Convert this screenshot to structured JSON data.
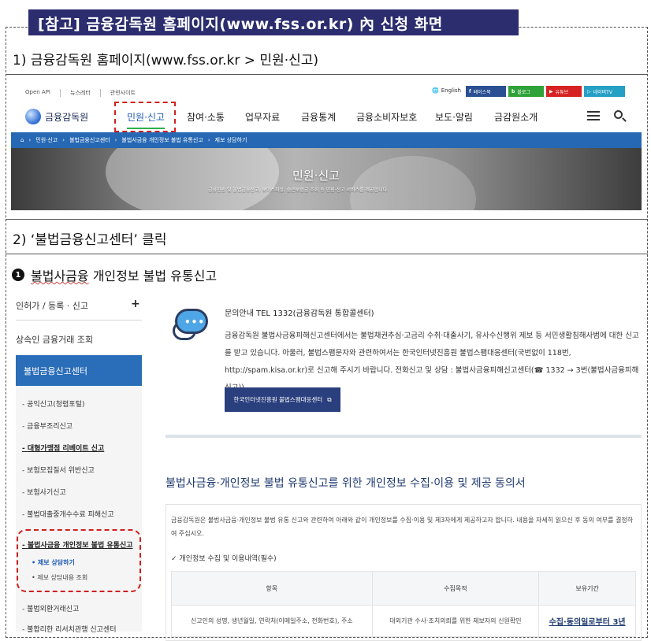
{
  "banner_title": "[참고] 금융감독원 홈페이지(www.fss.or.kr) 內 신청 화면",
  "step1": "1)  금융감독원 홈페이지(www.fss.or.kr  >  민원·신고)",
  "step2": "2)  ‘불법금융신고센터’ 클릭",
  "site": {
    "util_links": [
      "Open API",
      "뉴스레터",
      "관련사이트"
    ],
    "lang": "English",
    "social": [
      "페이스북",
      "블로그",
      "유튜브",
      "네이버TV"
    ],
    "logo": "금융감독원",
    "menu": [
      "민원·신고",
      "참여·소통",
      "업무자료",
      "금융통계",
      "금융소비자보호",
      "보도·알림",
      "금감원소개"
    ],
    "breadcrumb": [
      "민원·신고",
      "불법금융신고센터",
      "불법사금융 개인정보 불법 유통신고",
      "제보 상담하기"
    ],
    "hero_title": "민원·신고",
    "hero_sub": "금융민원 및 불법금융신고, 보이스피싱, 숨은보험금 조회 등 민원·신고 서비스를 제공합니다."
  },
  "bullet": {
    "num": "1",
    "part1": "불법사금융",
    "part2": " 개인정보 불법 유통신고"
  },
  "left_nav": {
    "top_items": [
      "인허가 / 등록 · 신고",
      "상속인 금융거래 조회"
    ],
    "plus": "+",
    "active": "불법금융신고센터",
    "sub_items": [
      "공익신고(청렴포털)",
      "금융부조리신고",
      "대형가맹점 리베이트 신고",
      "보험모집질서 위반신고",
      "보험사기신고",
      "불법대출중개수수료 피해신고"
    ],
    "current": "불법사금융 개인정보 불법 유통신고",
    "current_sub": [
      "제보 상담하기",
      "제보 상담내용 조회"
    ],
    "after_items": [
      "불법외환거래신고",
      "불합리한 리서치관행 신고센터"
    ]
  },
  "content": {
    "icon_dots": "•••",
    "info_title": "문의안내 TEL 1332(금융감독원 통합콜센터)",
    "info_body": "금융감독원 불법사금융피해신고센터에서는 불법채권추심·고금리 수취·대출사기, 유사수신행위 제보 등 서민생활침해사범에 대한 신고를 받고 있습니다. 아울러, 불법스팸문자와 관련하여서는 한국인터넷진흥원 불법스팸대응센터(국번없이 118번, http://spam.kisa.or.kr)로 신고해 주시기 바랍니다. 전화신고 및 상담 : 불법사금융피해신고센터(☎ 1332 → 3번(불법사금융피해신고))",
    "spam_button": "한국인터넷진흥원 불법스팸대응센터",
    "consent_title": "불법사금융·개인정보 불법 유통신고를 위한 개인정보 수집·이용 및 제공 동의서",
    "consent_desc": "금융감독원은 불법사금융·개인정보 불법 유통 신고와 관련하여 아래와 같이 개인정보를 수집·이용 및 제3자에게 제공하고자 합니다. 내용을 자세히 읽으신 후 동의 여부를 결정하여 주십시오.",
    "check_title": "개인정보 수집 및 이용내역(필수)",
    "table": {
      "headers": [
        "항목",
        "수집목적",
        "보유기간"
      ],
      "row": [
        "신고인의 성명, 생년월일, 연락처(이메일주소, 전화번호), 주소",
        "대외기관 수사·조치의뢰를 위한 제보자의 신원확인",
        "수집·동의일로부터 3년"
      ]
    }
  }
}
